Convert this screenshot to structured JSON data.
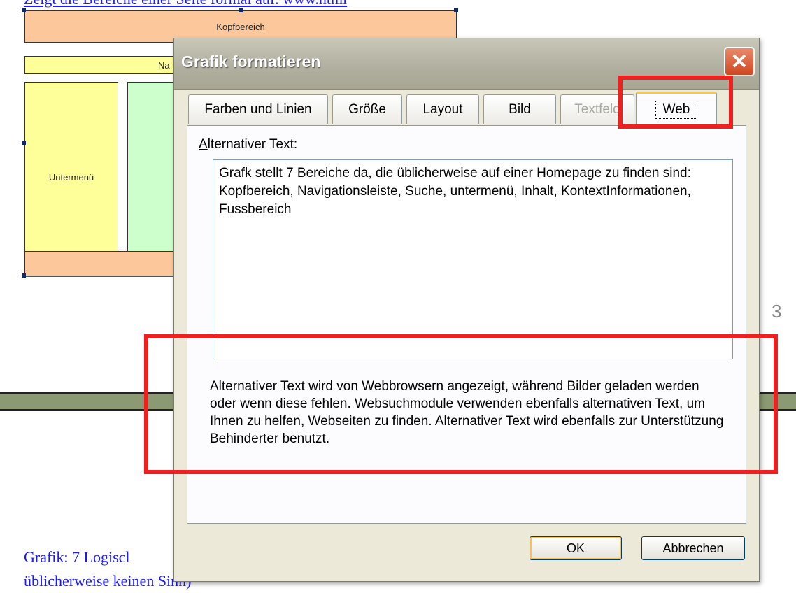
{
  "document": {
    "top_link": "Zeigt die Bereiche einer Seite formal auf. www.html",
    "diagram": {
      "kopfbereich": "Kopfbereich",
      "navigation_partial": "Na",
      "untermenue": "Untermenü"
    },
    "page_number": "3",
    "caption_line1": "Grafik: 7 Logiscl",
    "caption_line2": "üblicherweise keinen Sinn)"
  },
  "dialog": {
    "title": "Grafik formatieren",
    "close_glyph": "✕",
    "tabs": [
      {
        "label": "Farben und Linien",
        "state": "normal"
      },
      {
        "label": "Größe",
        "state": "normal"
      },
      {
        "label": "Layout",
        "state": "normal"
      },
      {
        "label": "Bild",
        "state": "normal"
      },
      {
        "label": "Textfeld",
        "state": "disabled"
      },
      {
        "label": "Web",
        "state": "active"
      }
    ],
    "alt_text_label_mnemonic": "A",
    "alt_text_label_rest": "lternativer Text:",
    "alt_text_value": "Grafk stellt 7 Bereiche da, die üblicherweise auf einer Homepage zu finden sind: Kopfbereich, Navigationsleiste, Suche, untermenü, Inhalt, KontextInformationen, Fussbereich",
    "info_text": "Alternativer Text wird von Webbrowsern angezeigt, während Bilder geladen werden oder wenn diese fehlen.  Websuchmodule verwenden ebenfalls alternativen Text, um Ihnen zu helfen, Webseiten zu finden. Alternativer Text wird ebenfalls zur Unterstützung Behinderter benutzt.",
    "ok_label": "OK",
    "cancel_label": "Abbrechen"
  },
  "colors": {
    "highlight": "#ee2020",
    "link_blue": "#1a1aff",
    "dialog_bg": "#ece9d8"
  }
}
